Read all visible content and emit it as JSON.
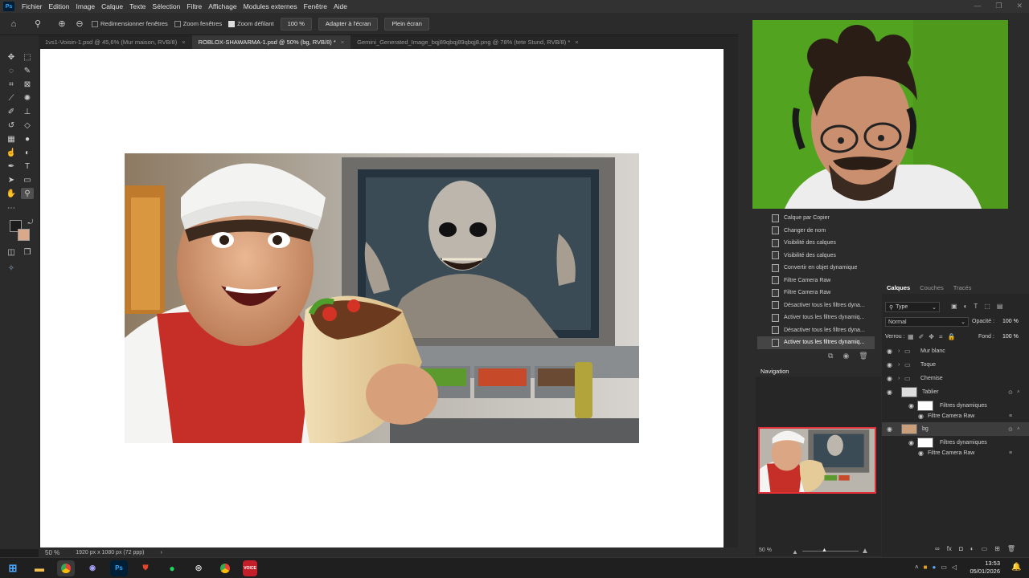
{
  "menubar": {
    "logo": "Ps",
    "items": [
      "Fichier",
      "Edition",
      "Image",
      "Calque",
      "Texte",
      "Sélection",
      "Filtre",
      "Affichage",
      "Modules externes",
      "Fenêtre",
      "Aide"
    ]
  },
  "options": {
    "resize_windows": "Redimensionner fenêtres",
    "zoom_windows": "Zoom fenêtres",
    "scrubby_zoom": "Zoom défilant",
    "zoom_value": "100 %",
    "fit_screen": "Adapter à l'écran",
    "full_screen": "Plein écran"
  },
  "tabs": [
    {
      "label": "1vs1-Voisin-1.psd @ 45,6% (Mur maison, RVB/8)",
      "active": false
    },
    {
      "label": "ROBLOX-SHAWARMA-1.psd @ 50% (bg, RVB/8) *",
      "active": true
    },
    {
      "label": "Gemini_Generated_Image_bqj89qbqj89qbqj8.png @ 78% (tete Stund, RVB/8) *",
      "active": false
    }
  ],
  "status": {
    "zoom": "50 %",
    "doc_size": "1920 px x 1080 px (72 ppp)"
  },
  "history": [
    "Calque par Copier",
    "Changer de nom",
    "Visibilité des calques",
    "Visibilité des calques",
    "Convertir en objet dynamique",
    "Filtre Camera Raw",
    "Filtre Camera Raw",
    "Désactiver tous les filtres dyna...",
    "Activer tous les filtres dynamiq...",
    "Désactiver tous les filtres dyna...",
    "Activer tous les filtres dynamiq..."
  ],
  "navigator": {
    "title": "Navigation",
    "zoom": "50 %"
  },
  "layers": {
    "tabs": [
      "Calques",
      "Couches",
      "Tracés"
    ],
    "filter": "Type",
    "blend_mode": "Normal",
    "opacity_label": "Opacité :",
    "opacity_value": "100 %",
    "lock_label": "Verrou :",
    "fill_label": "Fond :",
    "fill_value": "100 %",
    "items": [
      {
        "name": "Mur blanc",
        "kind": "group"
      },
      {
        "name": "Toque",
        "kind": "group"
      },
      {
        "name": "Chemise",
        "kind": "group"
      },
      {
        "name": "Tablier",
        "kind": "smart"
      },
      {
        "name": "Filtres dynamiques",
        "kind": "filters"
      },
      {
        "name": "Filtre Camera Raw",
        "kind": "filter"
      },
      {
        "name": "bg",
        "kind": "smart"
      },
      {
        "name": "Filtres dynamiques",
        "kind": "filters"
      },
      {
        "name": "Filtre Camera Raw",
        "kind": "filter"
      }
    ]
  },
  "taskbar": {
    "time": "13:53",
    "date": "05/01/2026",
    "app_voice": "VOICE"
  },
  "colors": {
    "accent": "#31a8ff",
    "greenscreen": "#52a320",
    "nav_frame": "#e0303a"
  }
}
